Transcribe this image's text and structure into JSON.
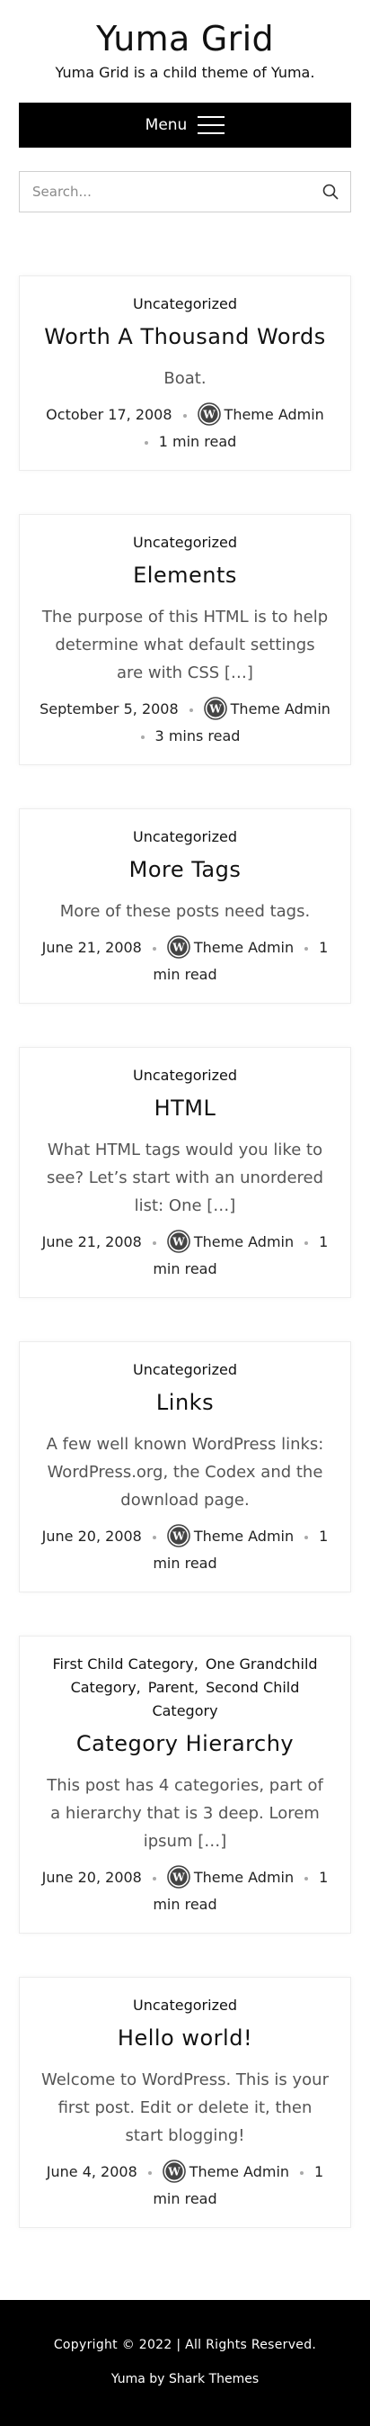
{
  "site": {
    "title": "Yuma Grid",
    "description": "Yuma Grid is a child theme of Yuma."
  },
  "menu": {
    "label": "Menu"
  },
  "search": {
    "placeholder": "Search..."
  },
  "posts": [
    {
      "categories": [
        "Uncategorized"
      ],
      "title": "Worth A Thousand Words",
      "excerpt": "Boat.",
      "date": "October 17, 2008",
      "author": "Theme Admin",
      "read_time": "1 min read"
    },
    {
      "categories": [
        "Uncategorized"
      ],
      "title": "Elements",
      "excerpt": "The purpose of this HTML is to help determine what default settings are with CSS […]",
      "date": "September 5, 2008",
      "author": "Theme Admin",
      "read_time": "3 mins read"
    },
    {
      "categories": [
        "Uncategorized"
      ],
      "title": "More Tags",
      "excerpt": "More of these posts need tags.",
      "date": "June 21, 2008",
      "author": "Theme Admin",
      "read_time": "1 min read"
    },
    {
      "categories": [
        "Uncategorized"
      ],
      "title": "HTML",
      "excerpt": "What HTML tags would you like to see? Let’s start with an unordered list: One […]",
      "date": "June 21, 2008",
      "author": "Theme Admin",
      "read_time": "1 min read"
    },
    {
      "categories": [
        "Uncategorized"
      ],
      "title": "Links",
      "excerpt": "A few well known WordPress links: WordPress.org, the Codex and the download page.",
      "date": "June 20, 2008",
      "author": "Theme Admin",
      "read_time": "1 min read"
    },
    {
      "categories": [
        "First Child Category",
        "One Grandchild Category",
        "Parent",
        "Second Child Category"
      ],
      "title": "Category Hierarchy",
      "excerpt": "This post has 4 categories, part of a hierarchy that is 3 deep. Lorem ipsum […]",
      "date": "June 20, 2008",
      "author": "Theme Admin",
      "read_time": "1 min read"
    },
    {
      "categories": [
        "Uncategorized"
      ],
      "title": "Hello world!",
      "excerpt": "Welcome to WordPress. This is your first post. Edit or delete it, then start blogging!",
      "date": "June 4, 2008",
      "author": "Theme Admin",
      "read_time": "1 min read"
    }
  ],
  "footer": {
    "copyright": "Copyright © 2022 | All Rights Reserved.",
    "credit_prefix": "Yuma by",
    "credit_link": "Shark Themes"
  }
}
